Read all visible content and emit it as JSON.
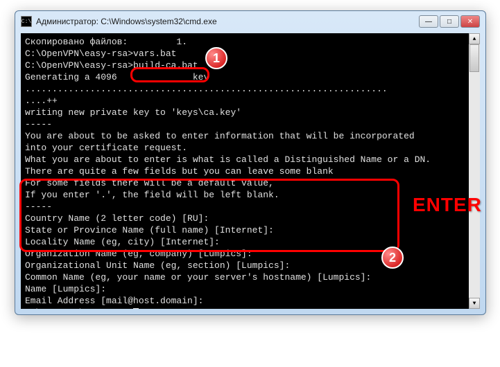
{
  "window": {
    "icon_label": "C:\\",
    "title": "Администратор: C:\\Windows\\system32\\cmd.exe"
  },
  "console": {
    "lines": [
      "Скопировано файлов:         1.",
      "",
      "C:\\OpenVPN\\easy-rsa>vars.bat",
      "",
      "C:\\OpenVPN\\easy-rsa>build-ca.bat",
      "Generating a 4096              key",
      "...................................................................",
      "....++",
      "writing new private key to 'keys\\ca.key'",
      "-----",
      "You are about to be asked to enter information that will be incorporated",
      "into your certificate request.",
      "What you are about to enter is what is called a Distinguished Name or a DN.",
      "There are quite a few fields but you can leave some blank",
      "For some fields there will be a default value,",
      "If you enter '.', the field will be left blank.",
      "-----",
      "Country Name (2 letter code) [RU]:",
      "State or Province Name (full name) [Internet]:",
      "Locality Name (eg, city) [Internet]:",
      "Organization Name (eg, company) [Lumpics]:",
      "Organizational Unit Name (eg, section) [Lumpics]:",
      "Common Name (eg, your name or your server's hostname) [Lumpics]:",
      "Name [Lumpics]:",
      "Email Address [mail@host.domain]:",
      "",
      "C:\\OpenVPN\\easy-rsa>"
    ]
  },
  "callouts": {
    "c1": "1",
    "c2": "2",
    "enter": "ENTER"
  },
  "winbtn": {
    "min": "—",
    "max": "□",
    "close": "✕"
  },
  "scroll": {
    "up": "▲",
    "down": "▼"
  }
}
